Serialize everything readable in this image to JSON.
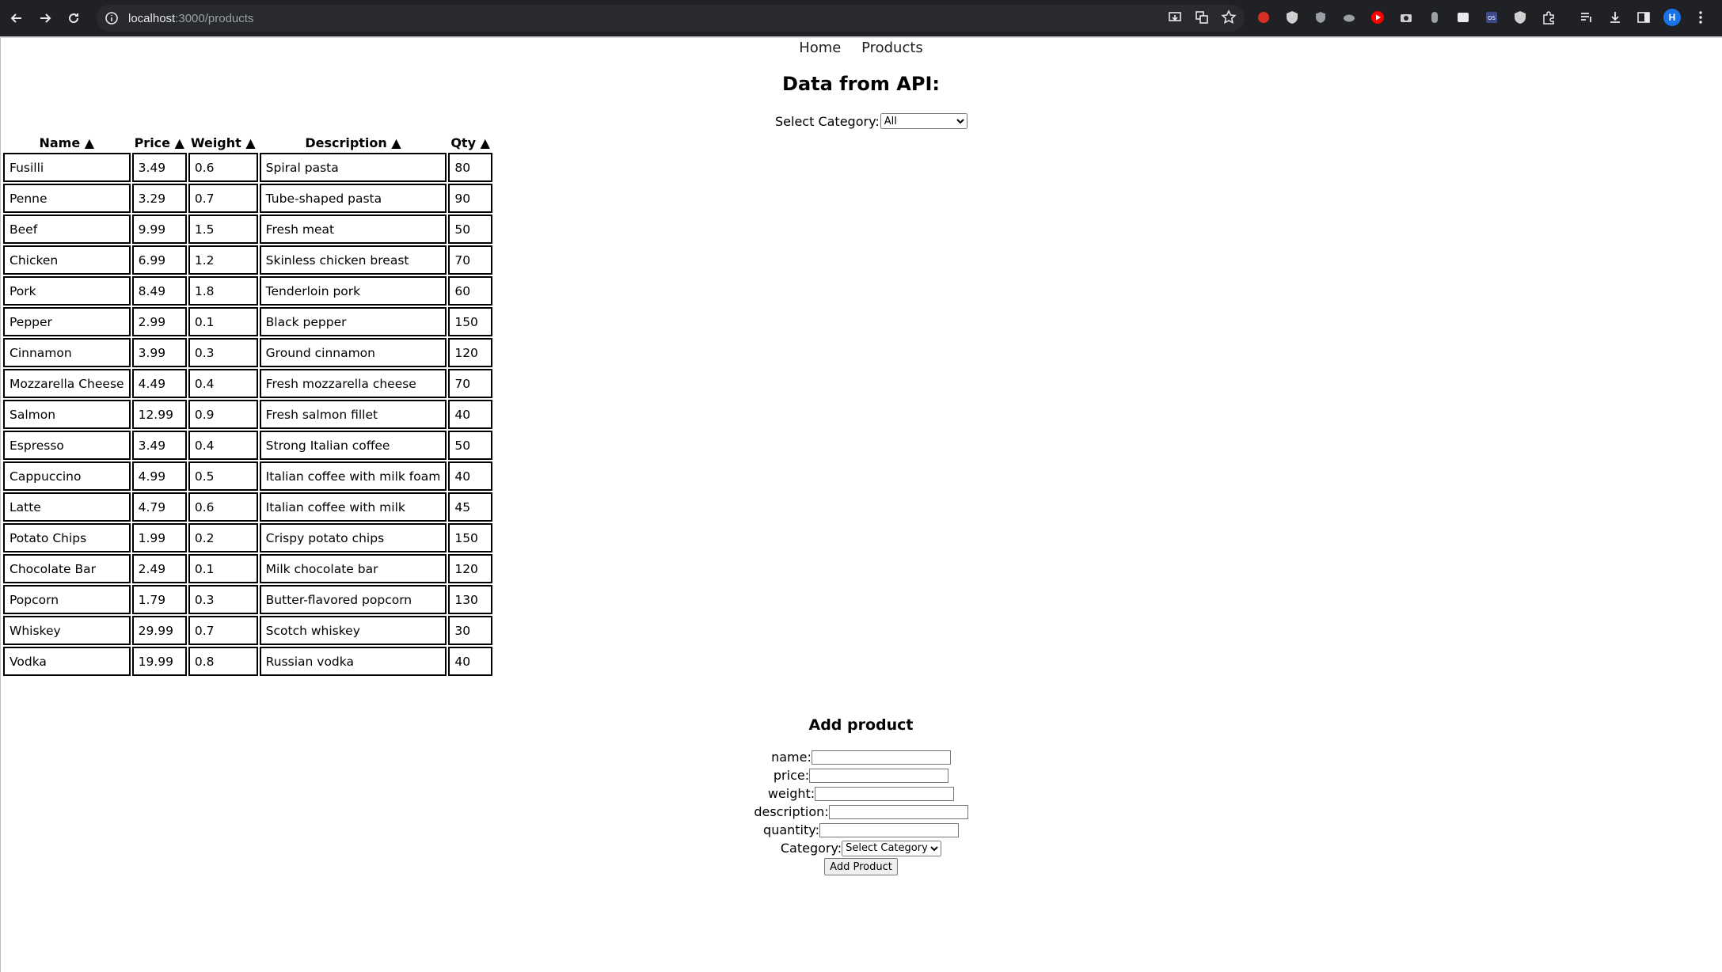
{
  "browser": {
    "url_host": "localhost",
    "url_path": ":3000/products",
    "profile_initial": "H"
  },
  "nav": {
    "home": "Home",
    "products": "Products"
  },
  "page_title": "Data from API:",
  "filter": {
    "label": "Select Category:",
    "selected": "All"
  },
  "table": {
    "headers": [
      "Name ▲",
      "Price ▲",
      "Weight ▲",
      "Description ▲",
      "Qty ▲"
    ],
    "rows": [
      [
        "Fusilli",
        "3.49",
        "0.6",
        "Spiral pasta",
        "80"
      ],
      [
        "Penne",
        "3.29",
        "0.7",
        "Tube-shaped pasta",
        "90"
      ],
      [
        "Beef",
        "9.99",
        "1.5",
        "Fresh meat",
        "50"
      ],
      [
        "Chicken",
        "6.99",
        "1.2",
        "Skinless chicken breast",
        "70"
      ],
      [
        "Pork",
        "8.49",
        "1.8",
        "Tenderloin pork",
        "60"
      ],
      [
        "Pepper",
        "2.99",
        "0.1",
        "Black pepper",
        "150"
      ],
      [
        "Cinnamon",
        "3.99",
        "0.3",
        "Ground cinnamon",
        "120"
      ],
      [
        "Mozzarella Cheese",
        "4.49",
        "0.4",
        "Fresh mozzarella cheese",
        "70"
      ],
      [
        "Salmon",
        "12.99",
        "0.9",
        "Fresh salmon fillet",
        "40"
      ],
      [
        "Espresso",
        "3.49",
        "0.4",
        "Strong Italian coffee",
        "50"
      ],
      [
        "Cappuccino",
        "4.99",
        "0.5",
        "Italian coffee with milk foam",
        "40"
      ],
      [
        "Latte",
        "4.79",
        "0.6",
        "Italian coffee with milk",
        "45"
      ],
      [
        "Potato Chips",
        "1.99",
        "0.2",
        "Crispy potato chips",
        "150"
      ],
      [
        "Chocolate Bar",
        "2.49",
        "0.1",
        "Milk chocolate bar",
        "120"
      ],
      [
        "Popcorn",
        "1.79",
        "0.3",
        "Butter-flavored popcorn",
        "130"
      ],
      [
        "Whiskey",
        "29.99",
        "0.7",
        "Scotch whiskey",
        "30"
      ],
      [
        "Vodka",
        "19.99",
        "0.8",
        "Russian vodka",
        "40"
      ]
    ]
  },
  "add_form": {
    "title": "Add product",
    "name_label": "name:",
    "price_label": "price:",
    "weight_label": "weight:",
    "description_label": "description:",
    "quantity_label": "quantity:",
    "category_label": "Category:",
    "category_selected": "Select Category",
    "button": "Add Product"
  }
}
